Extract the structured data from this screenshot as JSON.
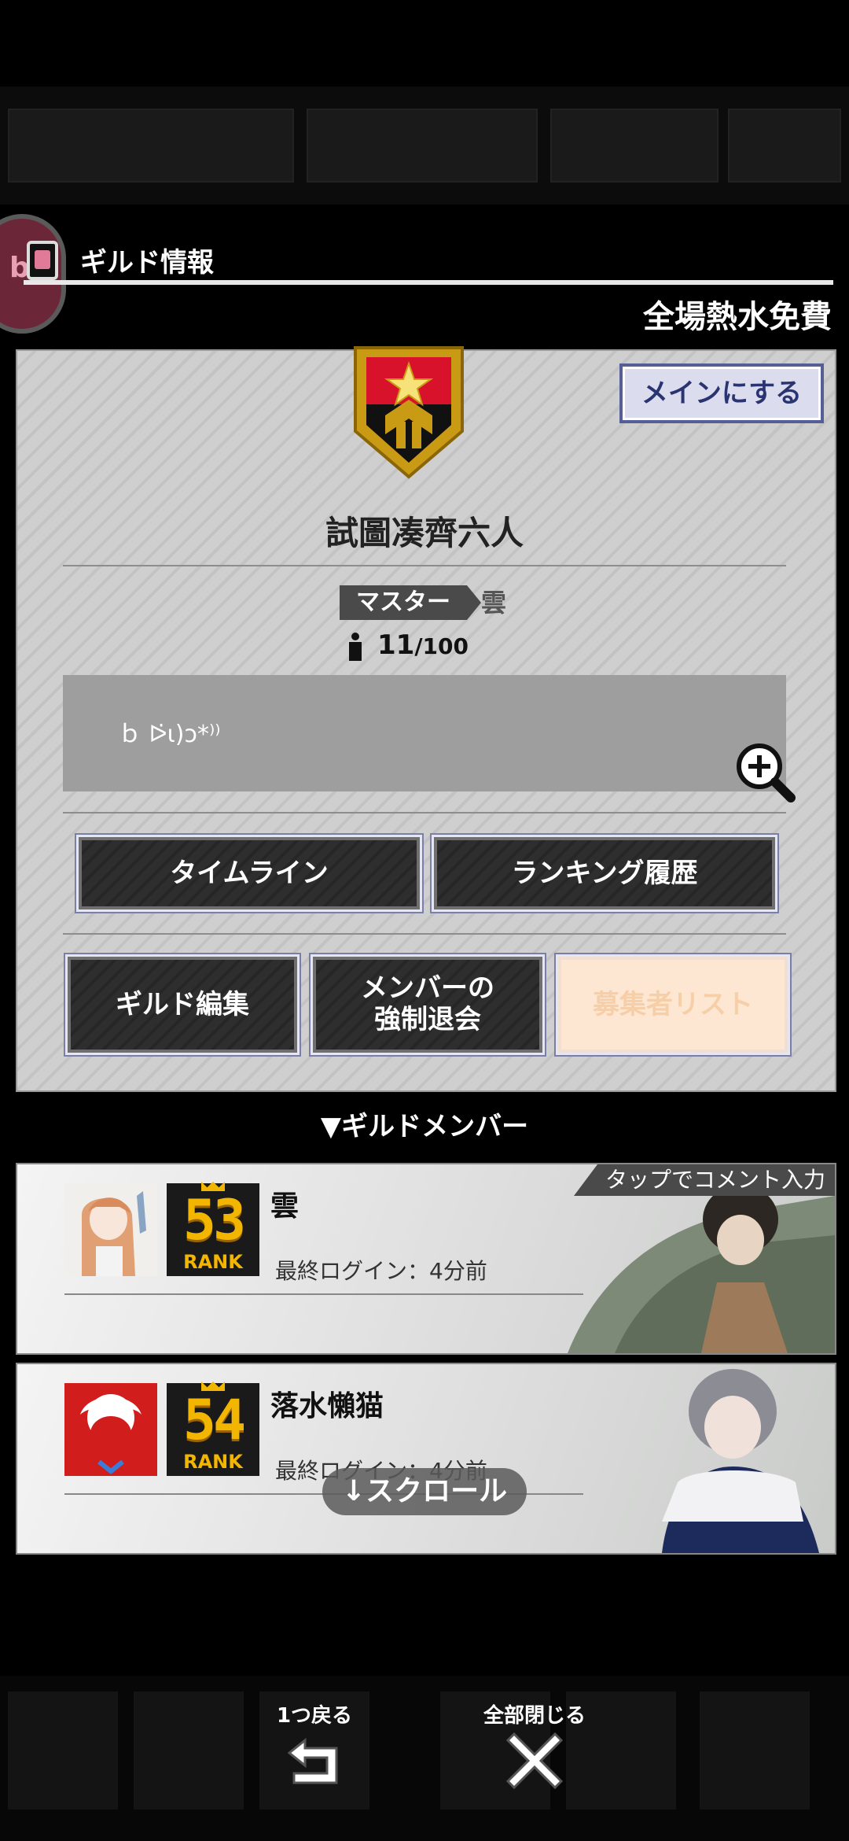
{
  "header": {
    "title": "ギルド情報",
    "right_label": "全場熱水免費",
    "side_badge": "b"
  },
  "guild": {
    "main_button": "メインにする",
    "name": "試圖凑齊六人",
    "master_label": "マスター",
    "master_name": "雲",
    "member_count": "11",
    "member_max": "/100",
    "comment": "ｂ ᐅ̇ɩ)ɔ*⁾⁾"
  },
  "actions": {
    "timeline": "タイムライン",
    "ranking_history": "ランキング履歴",
    "guild_edit": "ギルド編集",
    "force_leave_line1": "メンバーの",
    "force_leave_line2": "強制退会",
    "recruit_list": "募集者リスト"
  },
  "members_section": {
    "title": "▼ギルドメンバー",
    "tap_hint": "タップでコメント入力",
    "members": [
      {
        "name": "雲",
        "rank": "53",
        "rank_label": "RANK",
        "last_login": "最終ログイン：4分前"
      },
      {
        "name": "落水懶猫",
        "rank": "54",
        "rank_label": "RANK",
        "last_login": "最終ログイン：4分前"
      }
    ],
    "scroll_hint": "↓スクロール"
  },
  "footer": {
    "back_label": "1つ戻る",
    "close_all_label": "全部閉じる"
  },
  "colors": {
    "accent_blue": "#555f96",
    "rank_gold": "#f3b600",
    "emblem_red": "#d8122a",
    "emblem_gold": "#c99a14"
  }
}
